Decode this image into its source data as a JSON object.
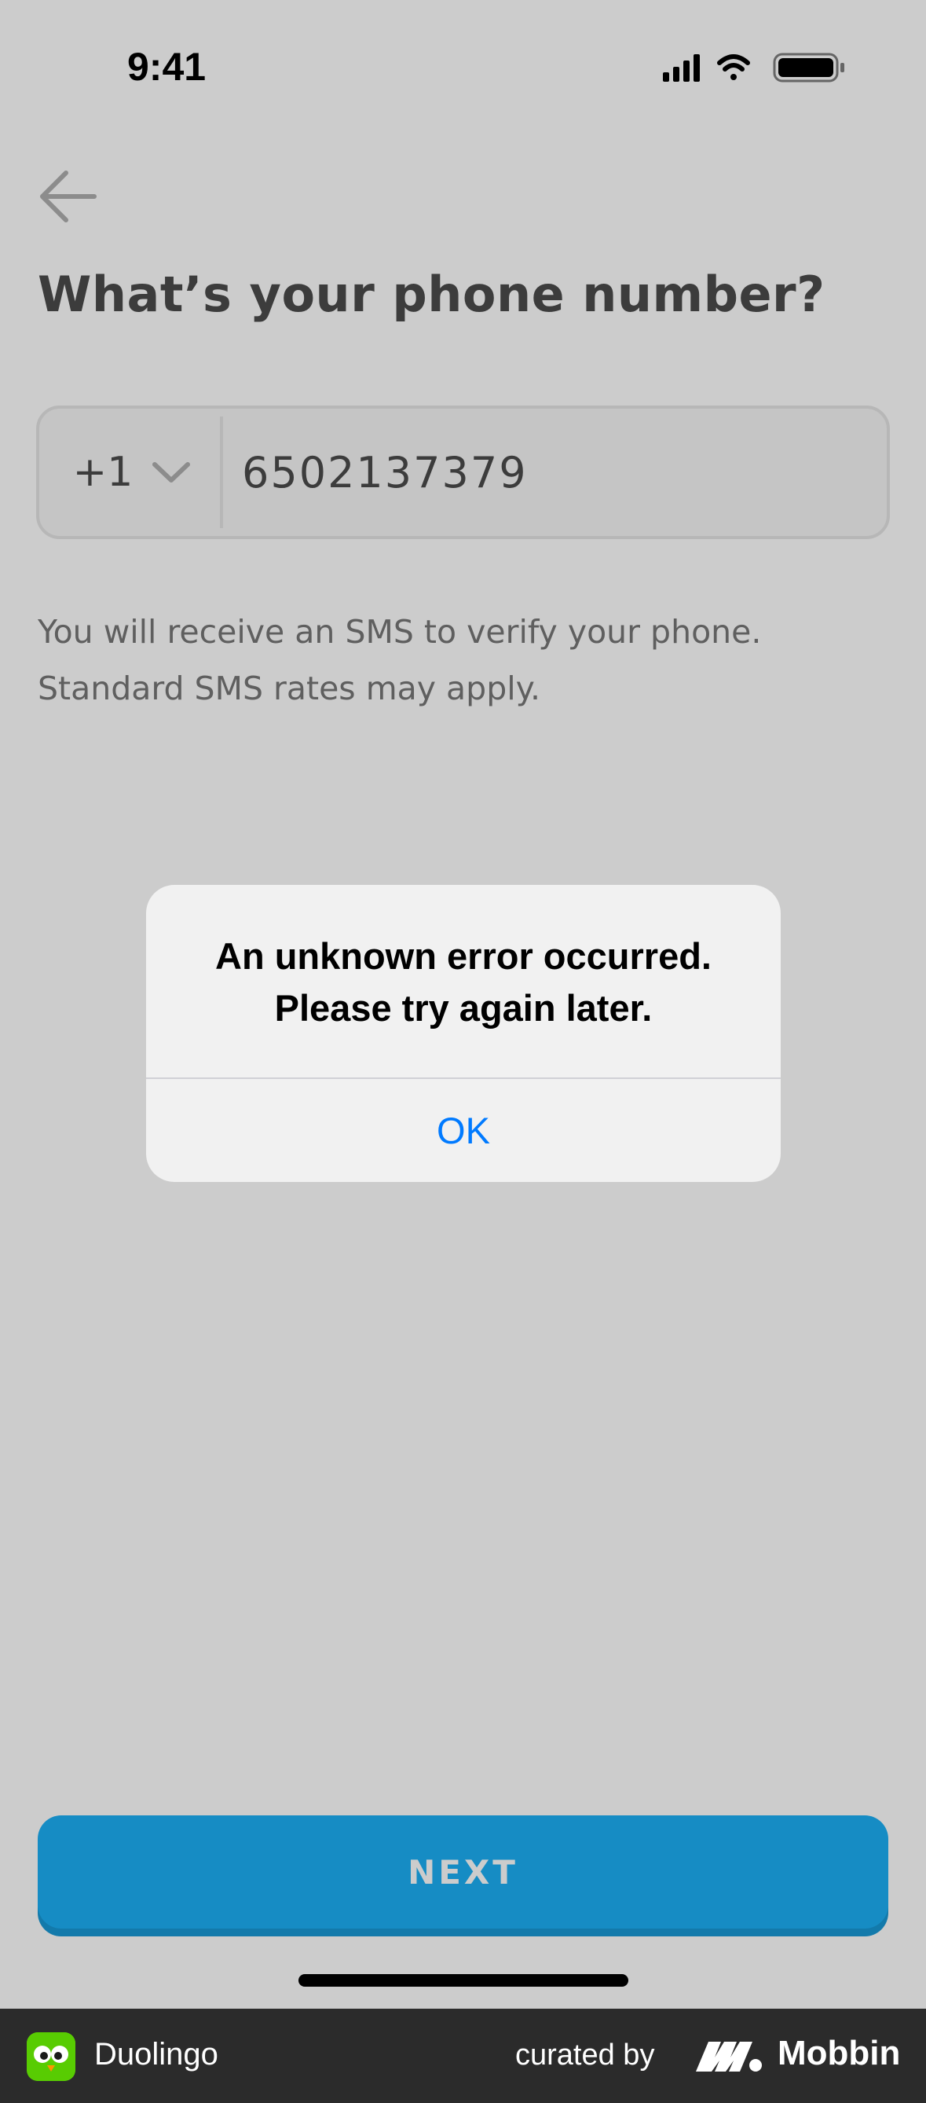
{
  "status_bar": {
    "time": "9:41"
  },
  "screen": {
    "title": "What’s your phone number?",
    "country_code": "+1",
    "phone_value": "6502137379",
    "helper_line1": "You will receive an SMS to verify your phone.",
    "helper_line2": "Standard SMS rates may apply.",
    "next_label": "NEXT"
  },
  "alert": {
    "line1": "An unknown error occurred.",
    "line2": "Please try again later.",
    "ok_label": "OK"
  },
  "footer": {
    "app_name": "Duolingo",
    "curated_by": "curated by",
    "brand": "Mobbin"
  },
  "colors": {
    "primary_blue": "#1cb0f6",
    "ios_link_blue": "#007aff",
    "duolingo_green": "#58cc02"
  }
}
